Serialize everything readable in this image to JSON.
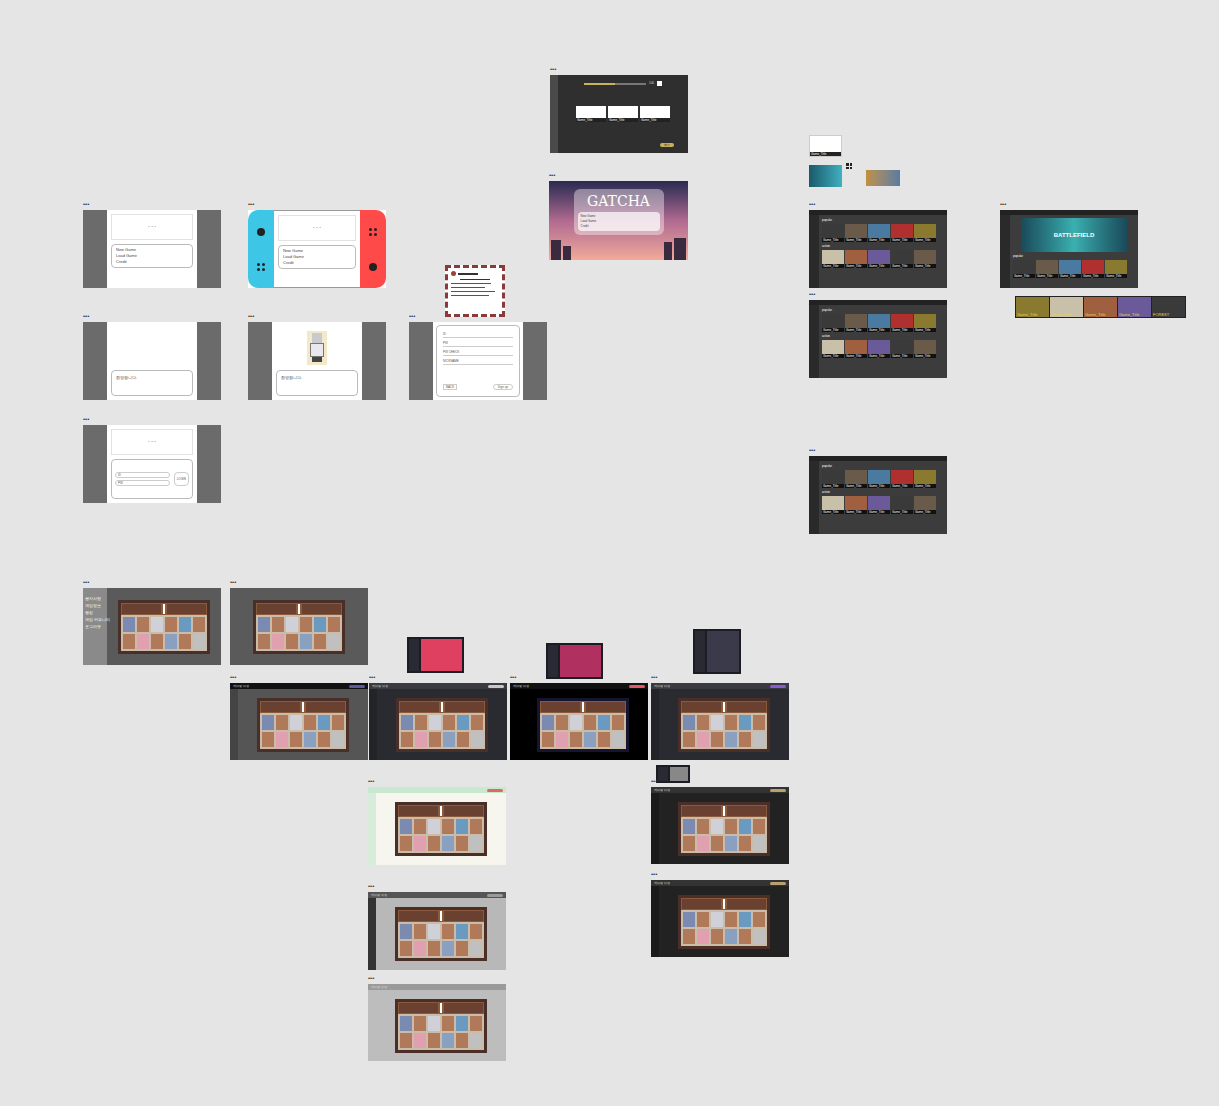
{
  "frame_label": "•••",
  "title_menu": {
    "placeholder": "- - -",
    "items": [
      "New Game",
      "Load Game",
      "Credit"
    ]
  },
  "dialog": {
    "text": "환영합니다."
  },
  "signup": {
    "fields": [
      "ID",
      "PW",
      "PW CHECK",
      "NICKNAME"
    ],
    "back": "BACK",
    "button": "Sign up"
  },
  "login": {
    "fields": [
      "ID",
      "PW"
    ],
    "button": "LOGIN"
  },
  "settings": {
    "level": 0.5,
    "reading": "100",
    "cards": [
      "Game_Title",
      "Game_Title",
      "Game_Title"
    ],
    "button": "확인",
    "checked": false
  },
  "gatcha": {
    "title": "GATCHA",
    "items": [
      "New Game",
      "Load Game",
      "Credit"
    ]
  },
  "store": {
    "sections": [
      {
        "label": "popular",
        "tiles": [
          "Game_Title",
          "Game_Title",
          "Game_Title",
          "Game_Title",
          "Game_Title"
        ]
      },
      {
        "label": "action",
        "tiles": [
          "Game_Title",
          "Game_Title",
          "Game_Title",
          "Game_Title",
          "Game_Title"
        ]
      }
    ],
    "banner": "BATTLEFIELD",
    "strip": [
      "Game_Title",
      "Game_Title",
      "Game_Title",
      "Game_Title",
      "FOREST"
    ],
    "card": "Game_Title"
  },
  "lobby_menu": [
    "공지사항",
    "게임정보",
    "랭킹",
    "게임 커뮤니티",
    "로그아웃"
  ],
  "rooms": [
    {
      "title": "게임방 입장",
      "accent": "#5a5aa0"
    },
    {
      "title": "게임방 입장",
      "accent": "#c8c8c8"
    },
    {
      "title": "게임방 입장",
      "accent": "#e05a6a"
    },
    {
      "title": "게임방 입장",
      "accent": "#8a5ad0"
    },
    {
      "title": "게임방 입장",
      "accent": "#e06a5a"
    },
    {
      "title": "게임방 입장",
      "accent": "#b8a070"
    },
    {
      "title": "게임방 입장",
      "accent": "#9a9a9a"
    },
    {
      "title": "게임방 입장",
      "accent": "#9a9a9a"
    },
    {
      "title": "게임방 입장",
      "accent": "#b8a070"
    }
  ]
}
